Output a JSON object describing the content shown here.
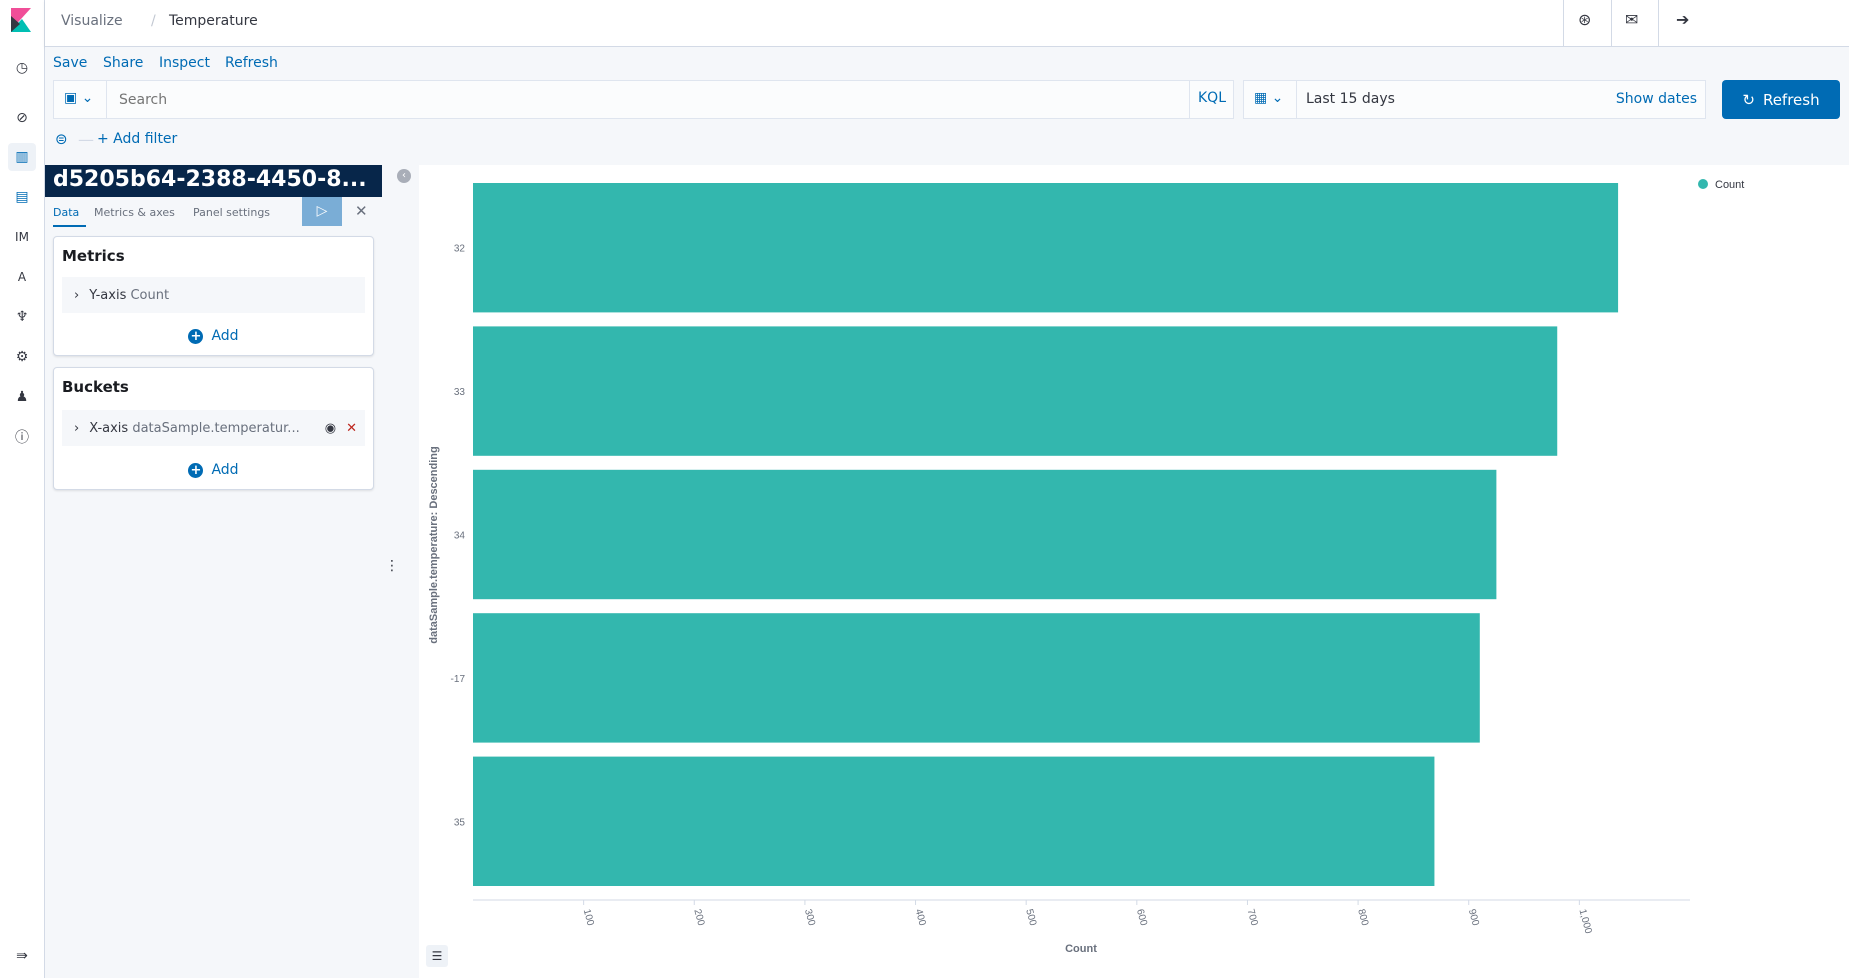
{
  "breadcrumbs": [
    "Visualize",
    "Temperature"
  ],
  "nav": {
    "items": [
      "clock-icon",
      "compass-icon",
      "visualize-icon",
      "dashboard-icon",
      "IM",
      "A",
      "dev-tools-icon",
      "gear-icon",
      "user-icon",
      "info-icon"
    ],
    "im_label": "IM",
    "a_label": "A"
  },
  "menu": {
    "save": "Save",
    "share": "Share",
    "inspect": "Inspect",
    "refresh": "Refresh"
  },
  "query": {
    "placeholder": "Search",
    "language": "KQL"
  },
  "time": {
    "range": "Last 15 days",
    "show_dates": "Show dates"
  },
  "refresh_button": "Refresh",
  "filter": {
    "add": "+ Add filter"
  },
  "editor": {
    "title": "d5205b64-2388-4450-8...",
    "tabs": [
      "Data",
      "Metrics & axes",
      "Panel settings"
    ],
    "metrics": {
      "heading": "Metrics",
      "item_axis": "Y-axis",
      "item_agg": "Count",
      "add": "Add"
    },
    "buckets": {
      "heading": "Buckets",
      "item_axis": "X-axis",
      "item_field": "dataSample.temperatur...",
      "add": "Add"
    }
  },
  "colors": {
    "bar": "#33b7ae",
    "accent": "#006bb4",
    "title_bg": "#07264a"
  },
  "chart_data": {
    "type": "bar",
    "orientation": "horizontal",
    "categories": [
      "32",
      "33",
      "34",
      "-17",
      "35"
    ],
    "series": [
      {
        "name": "Count",
        "values": [
          1035,
          980,
          925,
          910,
          869
        ]
      }
    ],
    "xlabel": "Count",
    "ylabel": "dataSample.temperature: Descending",
    "xticks": [
      "100",
      "200",
      "300",
      "400",
      "500",
      "600",
      "700",
      "800",
      "900",
      "1,000"
    ],
    "xlim": [
      0,
      1100
    ],
    "legend": "top-right",
    "grid": false
  }
}
